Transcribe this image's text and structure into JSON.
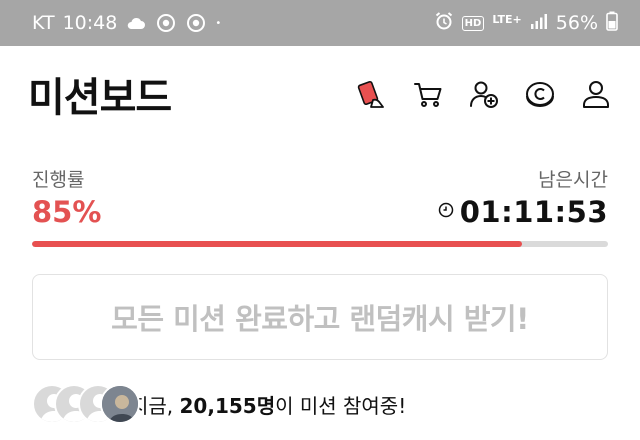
{
  "status_bar": {
    "carrier": "KT",
    "time": "10:48",
    "network": "LTE+",
    "hd": "HD",
    "battery": "56%",
    "dot": "•"
  },
  "header": {
    "title": "미션보드",
    "icons": [
      "mission-card-icon",
      "cart-icon",
      "add-friend-icon",
      "coin-icon",
      "profile-icon"
    ]
  },
  "progress": {
    "label": "진행률",
    "value": "85%",
    "fraction": 0.85
  },
  "remaining": {
    "label": "남은시간",
    "value": "01:11:53"
  },
  "cta": {
    "label": "모든 미션 완료하고 랜덤캐시 받기!"
  },
  "participants": {
    "prefix": "지금, ",
    "count": "20,155명",
    "suffix": "이 미션 참여중!"
  },
  "colors": {
    "accent": "#e85050",
    "progress_text": "#e35252",
    "status_bar": "#a6a6a6"
  }
}
